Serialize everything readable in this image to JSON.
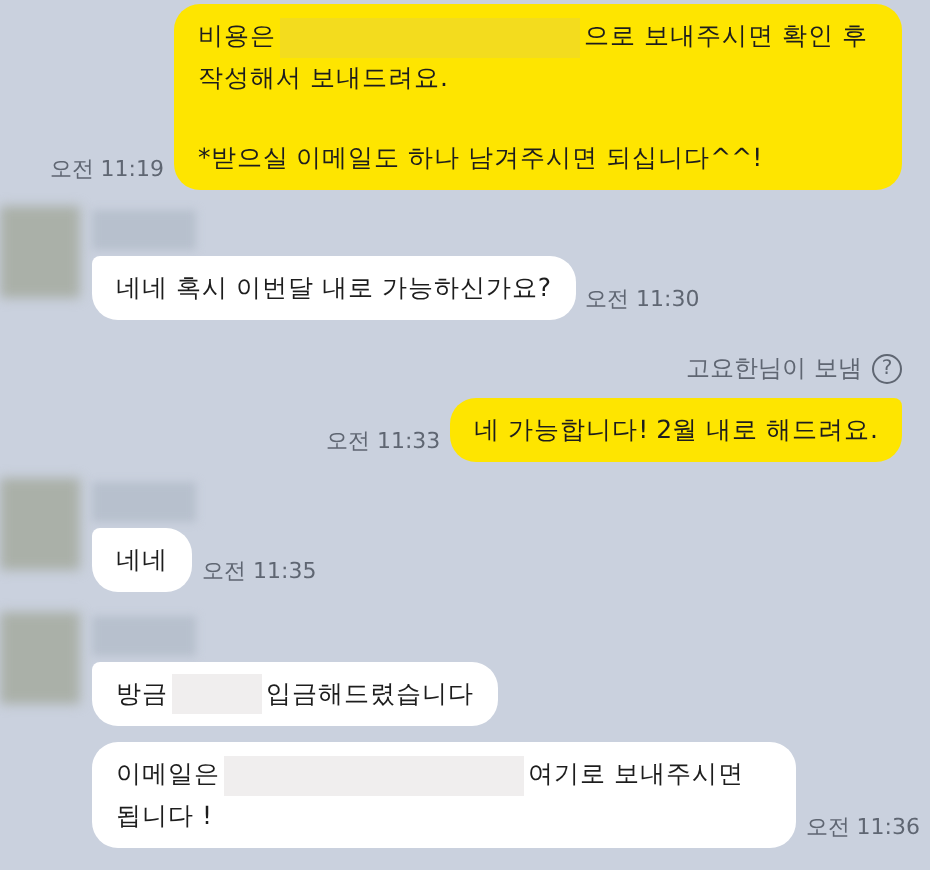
{
  "messages": [
    {
      "kind": "me",
      "tail": false,
      "time": "오전 11:19",
      "paragraphs": [
        [
          {
            "kind": "text",
            "text": "비용은"
          },
          {
            "kind": "redacted-long"
          },
          {
            "kind": "text",
            "text": "으로 보내주시면 확인 후 작성해서 보내드려요."
          }
        ],
        [
          {
            "kind": "text",
            "text": "*받으실 이메일도 하나 남겨주시면 되십니다^^!"
          }
        ]
      ]
    },
    {
      "kind": "them",
      "show_avatar": true,
      "time": "오전 11:30",
      "paragraphs": [
        [
          {
            "kind": "text",
            "text": "네네 혹시 이번달 내로 가능하신가요?"
          }
        ]
      ]
    },
    {
      "kind": "note",
      "text": "고요한님이 보냄",
      "icon": "?"
    },
    {
      "kind": "me",
      "tail": true,
      "time": "오전 11:33",
      "paragraphs": [
        [
          {
            "kind": "text",
            "text": "네 가능합니다! 2월 내로 해드려요."
          }
        ]
      ]
    },
    {
      "kind": "them",
      "show_avatar": true,
      "time": "오전 11:35",
      "paragraphs": [
        [
          {
            "kind": "text",
            "text": "네네"
          }
        ]
      ]
    },
    {
      "kind": "them",
      "show_avatar": true,
      "paragraphs": [
        [
          {
            "kind": "text",
            "text": "방금"
          },
          {
            "kind": "redacted-short"
          },
          {
            "kind": "text",
            "text": "입금해드렸습니다"
          }
        ]
      ]
    },
    {
      "kind": "them",
      "show_avatar": false,
      "time": "오전 11:36",
      "paragraphs": [
        [
          {
            "kind": "text",
            "text": "이메일은"
          },
          {
            "kind": "redacted-long"
          },
          {
            "kind": "text",
            "text": "여기로 보내주시면 됩니다 !"
          }
        ]
      ]
    }
  ]
}
